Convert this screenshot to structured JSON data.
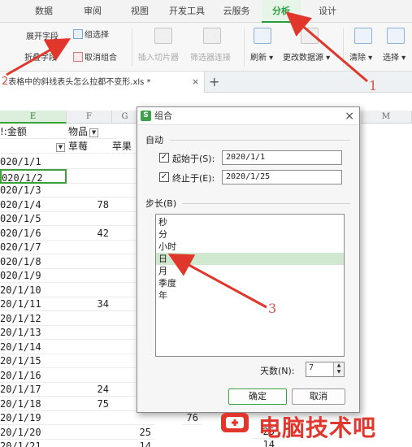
{
  "ribbon_tabs": [
    "数据",
    "审阅",
    "视图",
    "开发工具",
    "云服务",
    "分析",
    "设计"
  ],
  "ribbon": {
    "expand_field": "展开字段",
    "collapse_field": "折叠字段",
    "group_selection": "组选择",
    "ungroup": "取消组合",
    "insert_slicer": "插入切片器",
    "filter_connection": "筛选器连接",
    "refresh": "刷新",
    "change_source": "更改数据源",
    "clear": "清除",
    "select": "选择"
  },
  "file_tab": {
    "number_marker": "2",
    "name": "表格中的斜线表头怎么拉都不变形.xls *",
    "close": "×",
    "new_tab": "+"
  },
  "sheet": {
    "columns": [
      "E",
      "F",
      "G",
      "M"
    ],
    "pivot_header": {
      "label": "!:金额",
      "field": "物品",
      "items": [
        "草莓",
        "苹果"
      ]
    },
    "rows": [
      {
        "date": "020/1/1",
        "e": "",
        "f": ""
      },
      {
        "date": "020/1/2",
        "e": "",
        "f": ""
      },
      {
        "date": "020/1/3",
        "e": "",
        "f": ""
      },
      {
        "date": "020/1/4",
        "e": "78",
        "f": ""
      },
      {
        "date": "020/1/5",
        "e": "",
        "f": ""
      },
      {
        "date": "020/1/6",
        "e": "42",
        "f": ""
      },
      {
        "date": "020/1/7",
        "e": "",
        "f": ""
      },
      {
        "date": "020/1/8",
        "e": "",
        "f": ""
      },
      {
        "date": "020/1/9",
        "e": "",
        "f": ""
      },
      {
        "date": "20/1/10",
        "e": "",
        "f": ""
      },
      {
        "date": "20/1/11",
        "e": "34",
        "f": ""
      },
      {
        "date": "20/1/12",
        "e": "",
        "f": ""
      },
      {
        "date": "20/1/13",
        "e": "",
        "f": ""
      },
      {
        "date": "20/1/14",
        "e": "",
        "f": ""
      },
      {
        "date": "20/1/15",
        "e": "",
        "f": ""
      },
      {
        "date": "20/1/16",
        "e": "",
        "f": ""
      },
      {
        "date": "20/1/17",
        "e": "24",
        "f": ""
      },
      {
        "date": "20/1/18",
        "e": "75",
        "f": ""
      },
      {
        "date": "20/1/19",
        "e": "",
        "f": ""
      },
      {
        "date": "20/1/20",
        "e": "",
        "f": "25"
      },
      {
        "date": "20/1/21",
        "e": "",
        "f": "14"
      }
    ],
    "behind_dialog": {
      "v1": "76",
      "v2": "25",
      "v3": "14"
    }
  },
  "dialog": {
    "title": "组合",
    "auto_section": "自动",
    "start_label": "起始于(S):",
    "start_value": "2020/1/1",
    "end_label": "终止于(E):",
    "end_value": "2020/1/25",
    "step_label": "步长(B)",
    "steps": [
      "秒",
      "分",
      "小时",
      "日",
      "月",
      "季度",
      "年"
    ],
    "selected_step": "日",
    "days_label": "天数(N):",
    "days_value": "7",
    "ok": "确定",
    "cancel": "取消",
    "check_mark": "✓"
  },
  "annotations": {
    "n1": "1",
    "n2": "2",
    "n3": "3",
    "arrow_color": "#e0362b"
  },
  "watermark": {
    "text": "电脑技术吧"
  }
}
